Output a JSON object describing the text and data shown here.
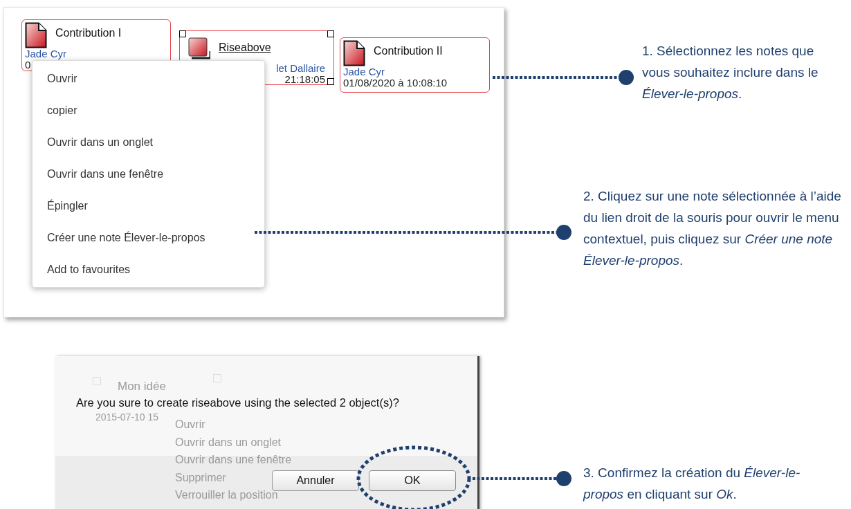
{
  "notes_view": {
    "notes": [
      {
        "kind": "note",
        "title": "Contribution I",
        "author": "Jade Cyr",
        "date": "0",
        "selected": true
      },
      {
        "kind": "riseabove",
        "title": "Riseabove",
        "author": "let Dallaire",
        "date": "21:18:05",
        "selected": true
      },
      {
        "kind": "note",
        "title": "Contribution II",
        "author": "Jade Cyr",
        "date": "01/08/2020 à 10:08:10",
        "selected": true
      }
    ],
    "context_menu": {
      "items": [
        "Ouvrir",
        "copier",
        "Ouvrir dans un onglet",
        "Ouvrir dans une fenêtre",
        "Épingler",
        "Créer une note Élever-le-propos",
        "Add to favourites"
      ]
    }
  },
  "dialog": {
    "background": {
      "note_title": "Mon idée",
      "note_date": "2015-07-10 15",
      "menu_items": [
        "Ouvrir",
        "Ouvrir dans un onglet",
        "Ouvrir dans une fenêtre",
        "Supprimer",
        "Verrouiller la position"
      ]
    },
    "message": "Are you sure to create riseabove using the selected 2 object(s)?",
    "buttons": [
      {
        "label": "Annuler",
        "kind": "cancel"
      },
      {
        "label": "OK",
        "kind": "default"
      }
    ]
  },
  "callouts": [
    {
      "text": "1. Sélectionnez les notes que vous souhaitez inclure dans le *Élever-le-propos*."
    },
    {
      "text": "2. Cliquez sur une note sélectionnée à l’aide du lien droit de la souris pour ouvrir le menu contextuel, puis cliquez sur *Créer une note Élever-le-propos*."
    },
    {
      "text": "3. Confirmez la création du *Élever-le-propos* en cliquant sur *Ok*."
    }
  ]
}
